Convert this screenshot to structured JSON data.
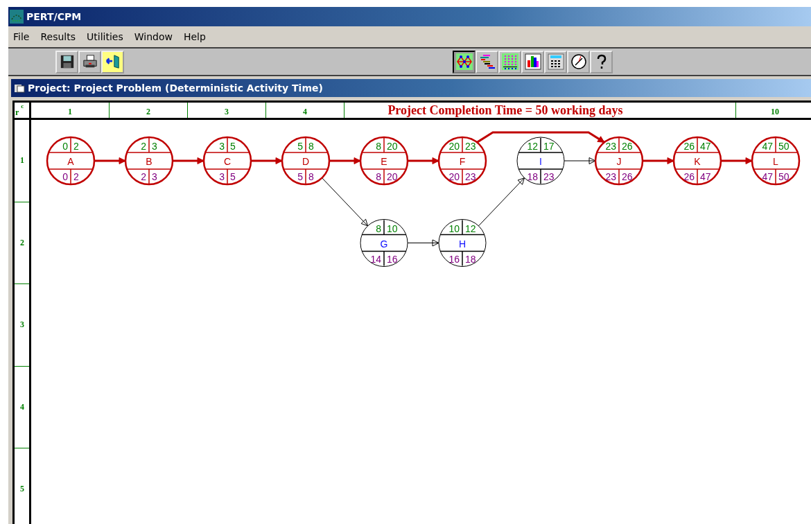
{
  "window": {
    "title": "PERT/CPM"
  },
  "menu": [
    "File",
    "Results",
    "Utilities",
    "Window",
    "Help"
  ],
  "toolbar_left": [
    {
      "kind": "save"
    },
    {
      "kind": "print"
    },
    {
      "kind": "exit"
    }
  ],
  "toolbar_right": [
    {
      "kind": "network",
      "selected": true
    },
    {
      "kind": "gantt",
      "selected": false
    },
    {
      "kind": "matrix",
      "selected": false
    },
    {
      "kind": "barchart",
      "selected": false
    },
    {
      "kind": "calculator",
      "selected": false
    },
    {
      "kind": "clock",
      "selected": false
    },
    {
      "kind": "help",
      "selected": false
    }
  ],
  "document": {
    "title": "Project: Project Problem (Deterministic Activity Time)"
  },
  "grid": {
    "row_mark": "r",
    "column_mark": "c",
    "columns": [
      "1",
      "2",
      "3",
      "4",
      "10"
    ],
    "completion_title": "Project Completion Time = 50 working days",
    "rows": [
      "1",
      "2",
      "3",
      "4",
      "5"
    ]
  },
  "nodes": [
    {
      "label": "A",
      "critical": true,
      "es": "0",
      "ef": "2",
      "ls": "0",
      "lf": "2"
    },
    {
      "label": "B",
      "critical": true,
      "es": "2",
      "ef": "3",
      "ls": "2",
      "lf": "3"
    },
    {
      "label": "C",
      "critical": true,
      "es": "3",
      "ef": "5",
      "ls": "3",
      "lf": "5"
    },
    {
      "label": "D",
      "critical": true,
      "es": "5",
      "ef": "8",
      "ls": "5",
      "lf": "8"
    },
    {
      "label": "E",
      "critical": true,
      "es": "8",
      "ef": "20",
      "ls": "8",
      "lf": "20"
    },
    {
      "label": "F",
      "critical": true,
      "es": "20",
      "ef": "23",
      "ls": "20",
      "lf": "23"
    },
    {
      "label": "I",
      "critical": false,
      "es": "12",
      "ef": "17",
      "ls": "18",
      "lf": "23"
    },
    {
      "label": "J",
      "critical": true,
      "es": "23",
      "ef": "26",
      "ls": "23",
      "lf": "26"
    },
    {
      "label": "K",
      "critical": true,
      "es": "26",
      "ef": "47",
      "ls": "26",
      "lf": "47"
    },
    {
      "label": "L",
      "critical": true,
      "es": "47",
      "ef": "50",
      "ls": "47",
      "lf": "50"
    },
    {
      "label": "G",
      "critical": false,
      "es": "8",
      "ef": "10",
      "ls": "14",
      "lf": "16"
    },
    {
      "label": "H",
      "critical": false,
      "es": "10",
      "ef": "12",
      "ls": "16",
      "lf": "18"
    }
  ]
}
